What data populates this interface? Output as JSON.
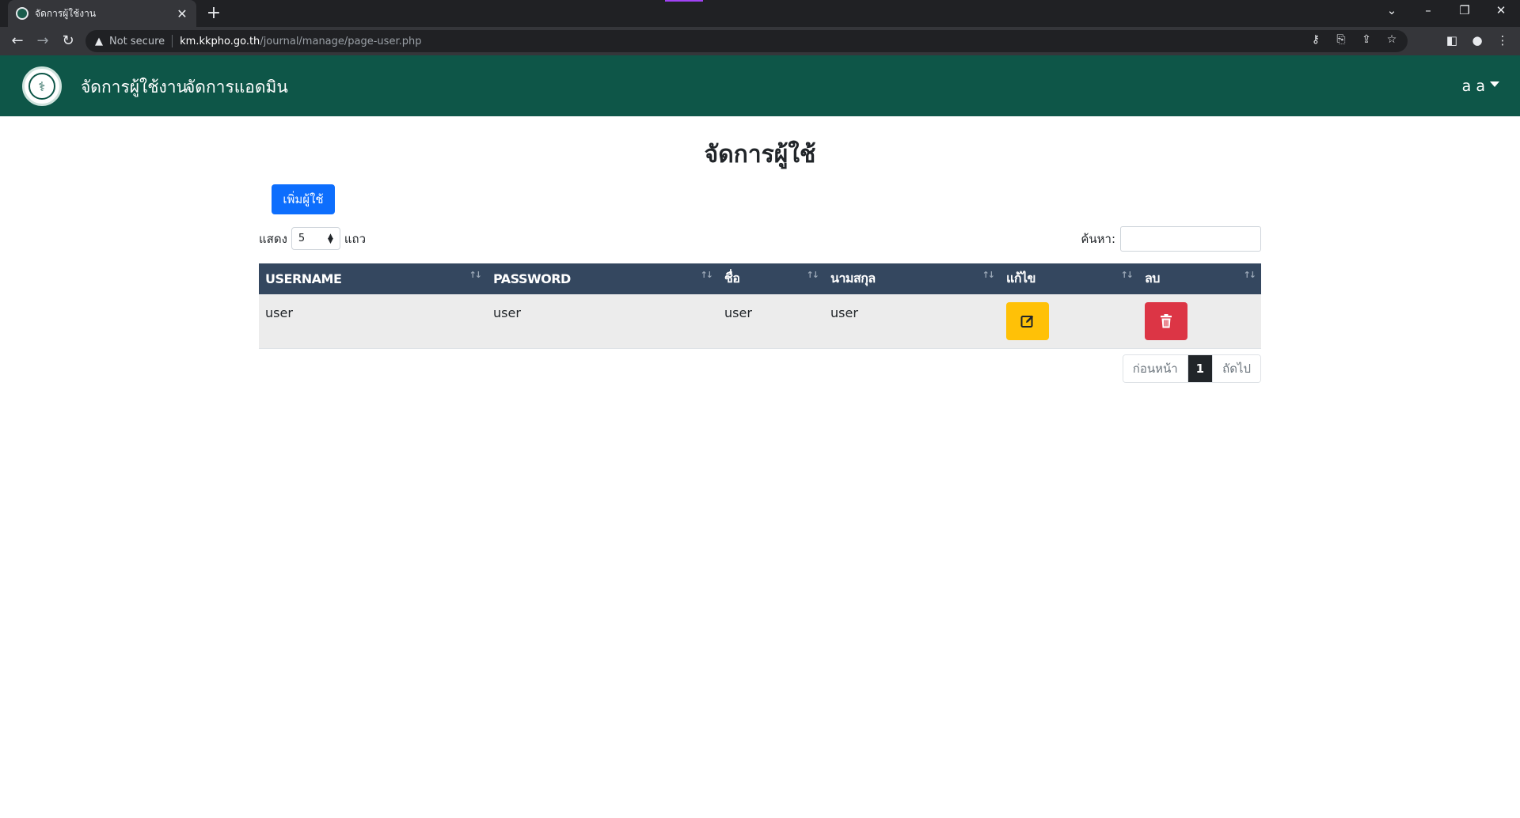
{
  "browser": {
    "tab_title": "จัดการผู้ใช้งาน",
    "url_security": "Not secure",
    "url_host": "km.kkpho.go.th",
    "url_path": "/journal/manage/page-user.php"
  },
  "navbar": {
    "links": [
      "จัดการผู้ใช้งาน",
      "จัดการแอดมิน"
    ],
    "user": "a a"
  },
  "page": {
    "title": "จัดการผู้ใช้",
    "add_button": "เพิ่มผู้ใช้",
    "show_label": "แสดง",
    "rows_label": "แถว",
    "page_length": "5",
    "search_label": "ค้นหา:",
    "search_value": ""
  },
  "table": {
    "columns": [
      "USERNAME",
      "PASSWORD",
      "ชื่อ",
      "นามสกุล",
      "แก้ไข",
      "ลบ"
    ],
    "rows": [
      {
        "username": "user",
        "password": "user",
        "first_name": "user",
        "last_name": "user"
      }
    ]
  },
  "pagination": {
    "previous": "ก่อนหน้า",
    "current": "1",
    "next": "ถัดไป"
  },
  "colors": {
    "navbar": "#0e5648",
    "table_header": "#34475f",
    "primary": "#0d6efd",
    "edit": "#ffc107",
    "delete": "#dc3545"
  }
}
